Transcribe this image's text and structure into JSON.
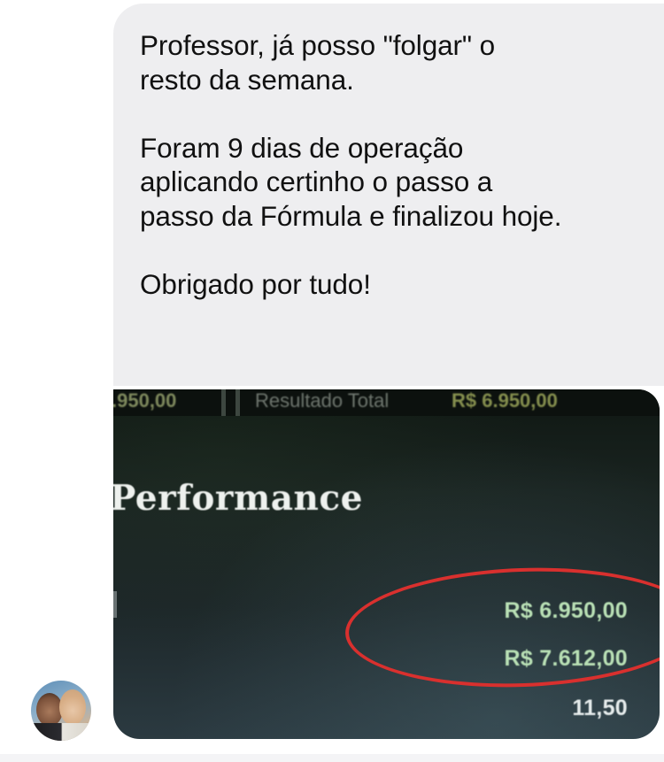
{
  "message": {
    "text": "Professor, já posso \"folgar\" o\nresto da semana.\n\nForam 9 dias de operação\naplicando certinho o passo a\npasso da Fórmula e finalizou hoje.\n\nObrigado por tudo!"
  },
  "attachment": {
    "top_left_value": ".950,00",
    "top_label": "Resultado Total",
    "top_right_value": "R$ 6.950,00",
    "heading": "Performance",
    "value_1": "R$ 6.950,00",
    "value_2": "R$ 7.612,00",
    "value_3": "11,50",
    "highlight_color": "#d9302e"
  },
  "sender": {
    "avatar": "profile-photo"
  }
}
